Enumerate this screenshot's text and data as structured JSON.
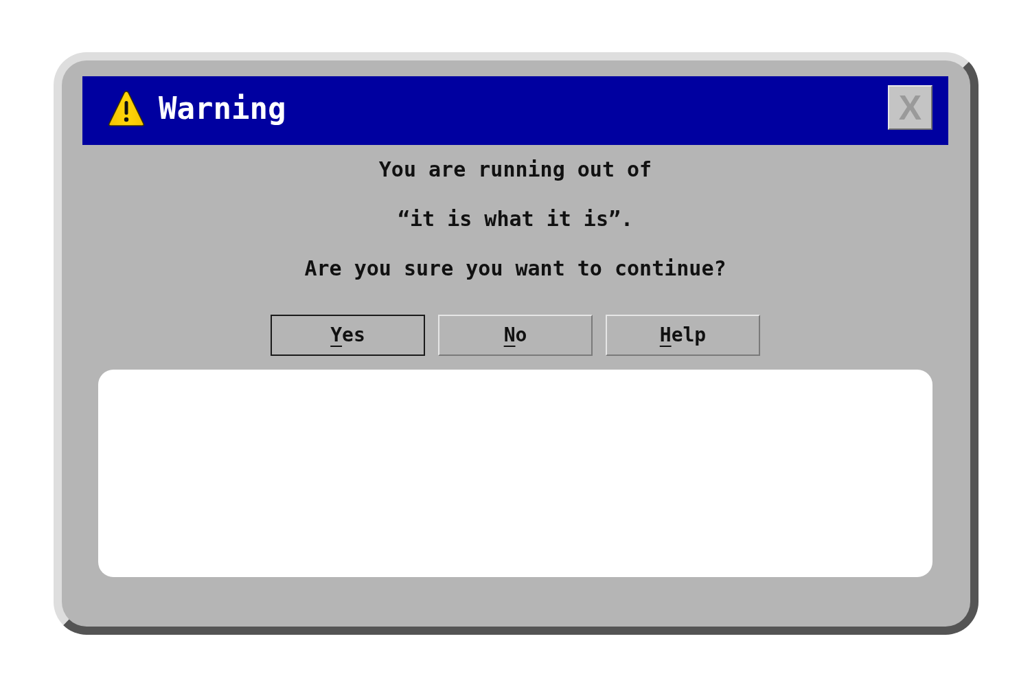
{
  "dialog": {
    "title": "Warning",
    "close_button": {
      "label": "X"
    },
    "message_lines": [
      "You are running out of",
      "“it is what it is”.",
      "Are you sure you want to continue?"
    ],
    "buttons": [
      {
        "label": "Yes",
        "default": true
      },
      {
        "label": "No",
        "default": false
      },
      {
        "label": "Help",
        "default": false
      }
    ]
  }
}
